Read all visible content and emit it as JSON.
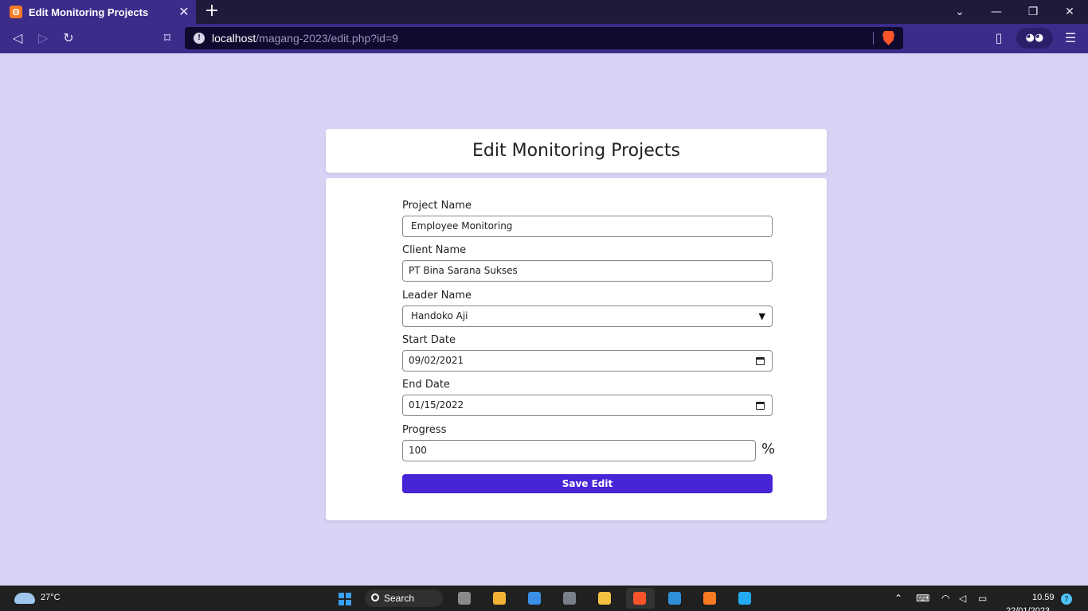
{
  "browser": {
    "tab_title": "Edit Monitoring Projects",
    "url_host": "localhost",
    "url_path": "/magang-2023/edit.php?id=9",
    "accent": "#3b2c8a"
  },
  "page": {
    "title": "Edit Monitoring Projects",
    "background": "#d9d2f5"
  },
  "form": {
    "project_name": {
      "label": "Project Name",
      "value": "Employee Monitoring"
    },
    "client_name": {
      "label": "Client Name",
      "value": "PT Bina Sarana Sukses"
    },
    "leader_name": {
      "label": "Leader Name",
      "value": "Handoko Aji"
    },
    "start_date": {
      "label": "Start Date",
      "value": "09/02/2021"
    },
    "end_date": {
      "label": "End Date",
      "value": "01/15/2022"
    },
    "progress": {
      "label": "Progress",
      "value": "100",
      "unit": "%"
    },
    "submit_label": "Save Edit",
    "submit_color": "#4725d6"
  },
  "taskbar": {
    "temperature": "27°C",
    "search_label": "Search",
    "time": "10.59",
    "date": "22/01/2023",
    "notification_count": "7"
  }
}
